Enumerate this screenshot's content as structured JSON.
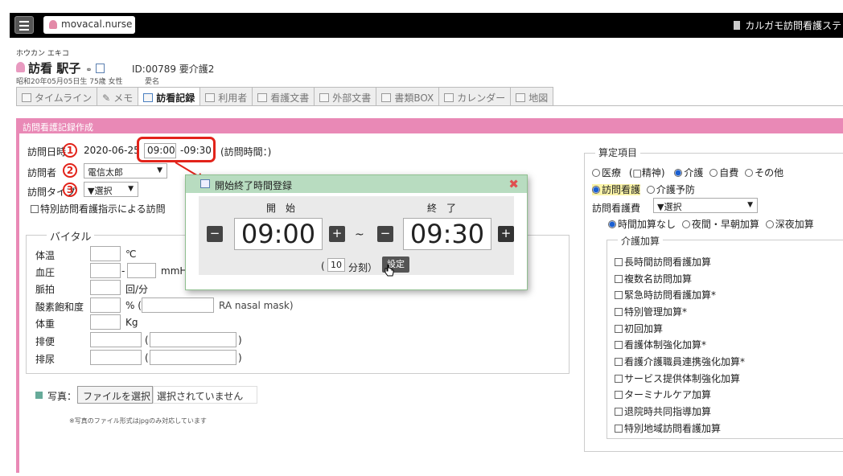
{
  "topbar": {
    "logo": "movacal.nurse",
    "corp": "カルガモ訪問看護ステ"
  },
  "patient": {
    "kana": "ホウカン エキコ",
    "name": "訪看 駅子",
    "id_line": "ID:00789 要介護2",
    "dob": "昭和20年05月05日生 75歳 女性",
    "nickname": "愛名"
  },
  "tabs": [
    "タイムライン",
    "メモ",
    "訪看記録",
    "利用者",
    "看護文書",
    "外部文書",
    "書類BOX",
    "カレンダー",
    "地図"
  ],
  "section_title": "訪問看護記録作成",
  "form": {
    "date_label": "訪問日時",
    "date": "2020-06-25",
    "start": "09:00",
    "end": "-09:30",
    "duration": "(訪問時間：)",
    "visitor_label": "訪問者",
    "visitor": "電信太郎",
    "type_label": "訪問タイプ",
    "type_select": "▼選択",
    "special": "特別訪問看護指示による訪問"
  },
  "vital": {
    "title": "バイタル",
    "temp": "体温",
    "temp_unit": "℃",
    "bp": "血圧",
    "bp_unit": "mmHg",
    "pulse": "脈拍",
    "pulse_unit": "回/分",
    "spo2": "酸素飽和度",
    "spo2_unit": "% (",
    "spo2_note": "RA nasal mask)",
    "weight": "体重",
    "weight_unit": "Kg",
    "stool": "排便",
    "urine": "排尿"
  },
  "photo": {
    "label": "写真：",
    "button": "ファイルを選択",
    "status": "選択されていません",
    "note": "※写真のファイル形式はjpgのみ対応しています"
  },
  "dialog": {
    "title": "開始終了時間登録",
    "start_label": "開　始",
    "end_label": "終　了",
    "start": "09:00",
    "end": "09:30",
    "tilde": "~",
    "step_open": "(",
    "step": "10",
    "step_close": "分刻）",
    "set_button": "設定"
  },
  "callouts": [
    "1",
    "2",
    "3"
  ],
  "right": {
    "title": "算定項目",
    "ins_radios": [
      "医療",
      "(□精神)",
      "介護",
      "自費",
      "その他"
    ],
    "service_radios": [
      "訪問看護",
      "介護予防"
    ],
    "fee_label": "訪問看護費",
    "fee_select": "▼選択",
    "time_radios": [
      "時間加算なし",
      "夜間・早朝加算",
      "深夜加算"
    ],
    "kaigo_title": "介護加算",
    "kaigo_items": [
      "長時間訪問看護加算",
      "複数名訪問加算",
      "緊急時訪問看護加算*",
      "特別管理加算*",
      "初回加算",
      "看護体制強化加算*",
      "看護介護職員連携強化加算*",
      "サービス提供体制強化加算",
      "ターミナルケア加算",
      "退院時共同指導加算",
      "特別地域訪問看護加算"
    ]
  }
}
